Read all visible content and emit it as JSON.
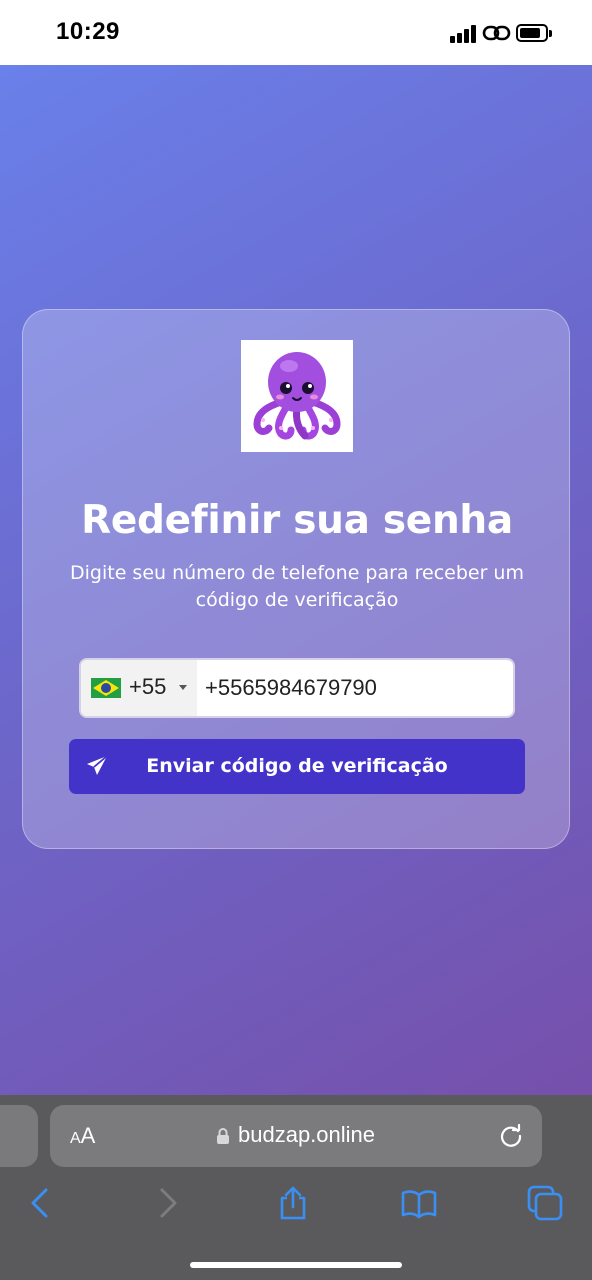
{
  "status_bar": {
    "time": "10:29"
  },
  "card": {
    "logo_icon": "octopus-mascot-icon",
    "title": "Redefinir sua senha",
    "subtitle": "Digite seu número de telefone para receber um código de verificação"
  },
  "phone": {
    "country_flag": "brazil-flag-icon",
    "dial_code": "+55",
    "value": "+5565984679790"
  },
  "send_button": {
    "label": "Enviar código de verificação",
    "icon": "paper-plane-icon"
  },
  "browser": {
    "aa_small": "A",
    "aa_large": "A",
    "url": "budzap.online"
  },
  "colors": {
    "accent_button": "#4433c9",
    "background_start": "#6a80ea",
    "background_end": "#7650ab",
    "safari_toolbar": "#5a5a5c",
    "safari_icon": "#3a8ff5"
  }
}
